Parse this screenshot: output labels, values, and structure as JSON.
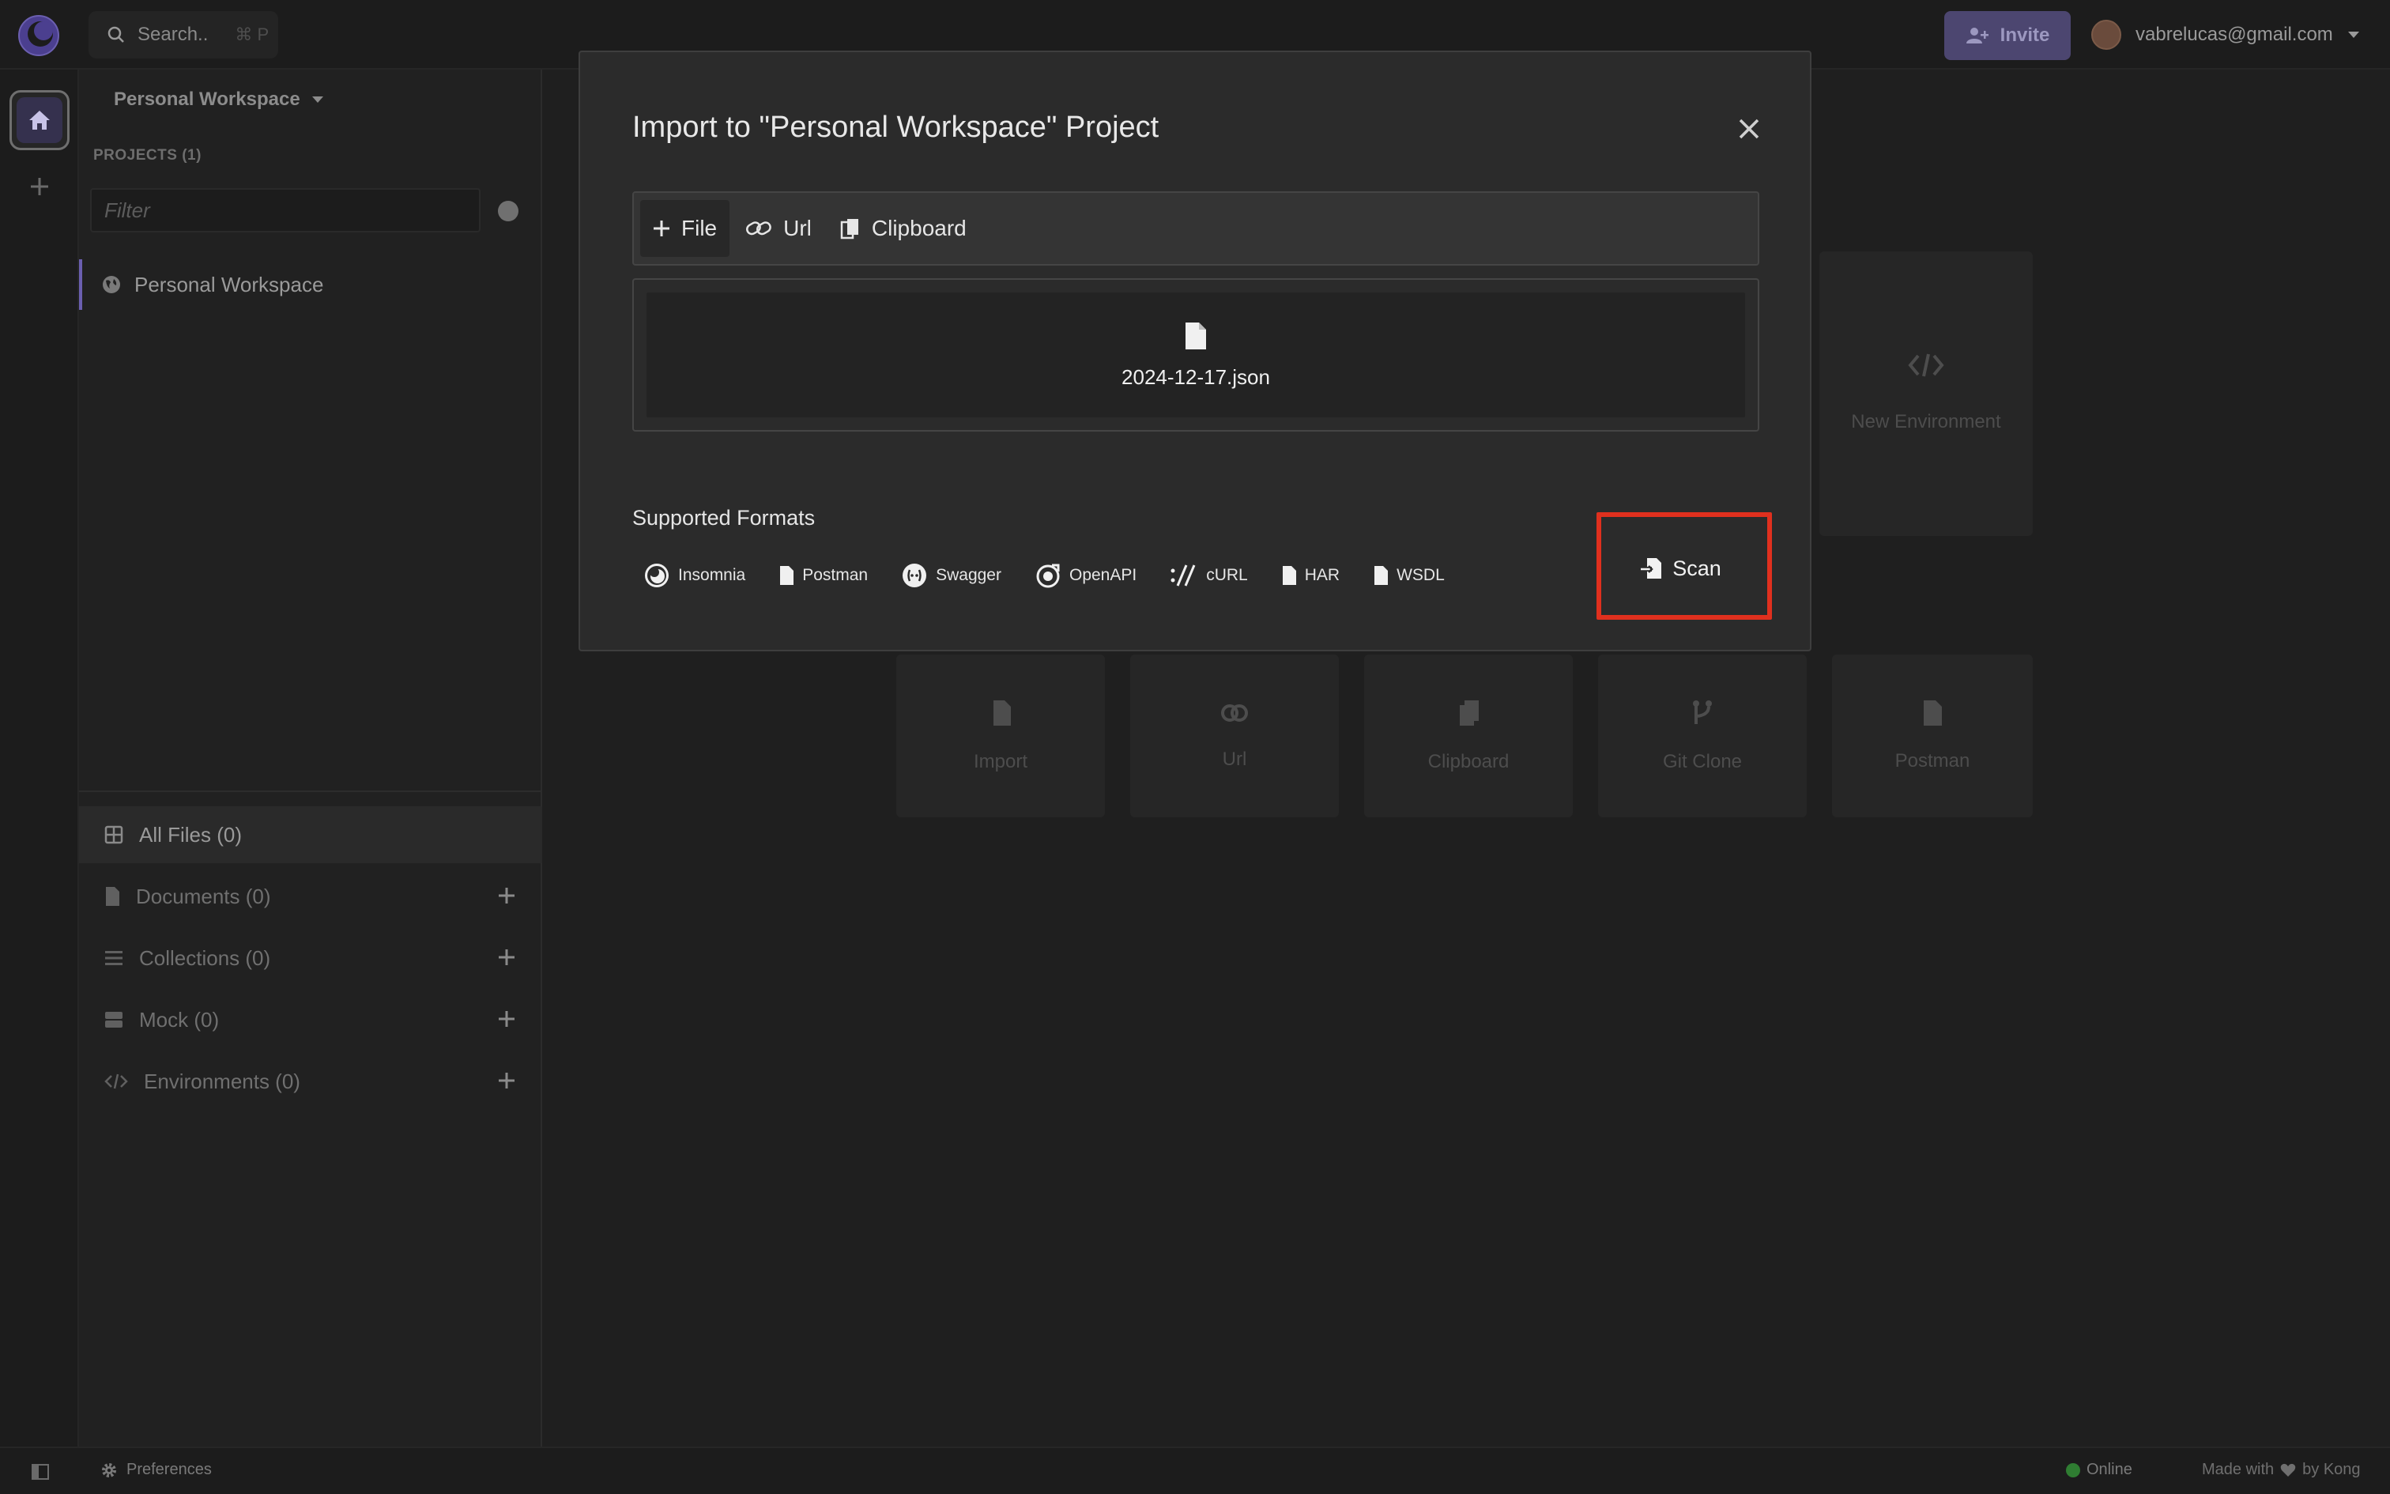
{
  "topbar": {
    "search_label": "Search..",
    "search_shortcut": "⌘ P",
    "invite_label": "Invite",
    "account_email": "vabrelucas@gmail.com"
  },
  "sidebar": {
    "workspace_title": "Personal Workspace",
    "projects_label": "PROJECTS (1)",
    "filter_placeholder": "Filter",
    "project_item": "Personal Workspace",
    "file_rows": [
      {
        "label": "All Files (0)",
        "icon": "grid-icon"
      },
      {
        "label": "Documents (0)",
        "icon": "document-icon"
      },
      {
        "label": "Collections (0)",
        "icon": "list-icon"
      },
      {
        "label": "Mock (0)",
        "icon": "server-icon"
      },
      {
        "label": "Environments (0)",
        "icon": "code-icon"
      }
    ]
  },
  "dashboard": {
    "new_environment": "New Environment",
    "import_tiles": [
      "Import",
      "Url",
      "Clipboard",
      "Git Clone",
      "Postman"
    ]
  },
  "modal": {
    "title": "Import to \"Personal Workspace\" Project",
    "tabs": [
      "File",
      "Url",
      "Clipboard"
    ],
    "selected_file": "2024-12-17.json",
    "formats_title": "Supported Formats",
    "formats": [
      "Insomnia",
      "Postman",
      "Swagger",
      "OpenAPI",
      "cURL",
      "HAR",
      "WSDL"
    ],
    "scan_label": "Scan",
    "highlight_color": "#e0301e"
  },
  "bottombar": {
    "preferences": "Preferences",
    "status": "Online",
    "made_with": "Made with",
    "by": "by Kong"
  },
  "colors": {
    "background": "#1f1f1f",
    "accent": "#6b5fb0",
    "invite_button": "#4c4670"
  }
}
